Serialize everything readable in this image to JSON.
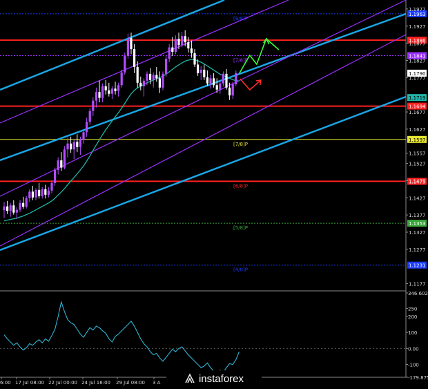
{
  "colors": {
    "background": "#000000",
    "bull": "#b34cff",
    "bear": "#ffffff",
    "ma": "#1fb5a8",
    "channel": "#1aa6e6",
    "inner_channel": "#9b30ff",
    "cci": "#2fb4d4",
    "murray_red": "#ff2020",
    "murray_yellow": "#e8e830",
    "murray_green": "#3aa63a",
    "murray_blue": "#1a3cff",
    "arrow_green": "#35ff35",
    "arrow_red": "#ff2b2b"
  },
  "logo": {
    "text": "instaforex"
  },
  "chart_data": {
    "type": "candlestick",
    "instrument": "",
    "timeframe": "",
    "x_tick_labels": [
      "6:00",
      "17 Jul 08:00",
      "22 Jul 00:00",
      "24 Jul 16:00",
      "29 Jul 08:00",
      "3 A"
    ],
    "y_tick_labels": [
      "1.1977",
      "1.1927",
      "1.1877",
      "1.1827",
      "1.1777",
      "1.1677",
      "1.1627",
      "1.1557",
      "1.1527",
      "1.1477",
      "1.1427",
      "1.1377",
      "1.1327",
      "1.1277",
      "1.1177"
    ],
    "ylim": [
      1.1162,
      1.1999
    ],
    "grid": false,
    "current_price": "1.1790",
    "moving_average_price": "1.1719",
    "murray_levels": [
      {
        "label": "8/8",
        "price": 1.1963,
        "price_text": "1.1963",
        "color": "#1a3cff"
      },
      {
        "label": "",
        "price": 1.1886,
        "price_text": "1.1886",
        "color": "#ff2020"
      },
      {
        "label": "7/8",
        "price": 1.1841,
        "price_text": "1.1841",
        "color": "#9b30ff"
      },
      {
        "label": "",
        "price": 1.1694,
        "price_text": "1.1694",
        "color": "#ff2020"
      },
      {
        "label": "7/8",
        "price": 1.1597,
        "price_text": "1.1597",
        "color": "#e8e830"
      },
      {
        "label": "6/8",
        "price": 1.1475,
        "price_text": "1.1475",
        "color": "#ff2020"
      },
      {
        "label": "5/8",
        "price": 1.1353,
        "price_text": "1.1353",
        "color": "#3aa63a"
      },
      {
        "label": "4/8",
        "price": 1.1231,
        "price_text": "1.1231",
        "color": "#1a3cff"
      }
    ],
    "candles": [
      {
        "o": 1.1391,
        "h": 1.1415,
        "l": 1.1368,
        "c": 1.1402
      },
      {
        "o": 1.1402,
        "h": 1.1418,
        "l": 1.138,
        "c": 1.1389
      },
      {
        "o": 1.1389,
        "h": 1.1412,
        "l": 1.1372,
        "c": 1.1405
      },
      {
        "o": 1.1405,
        "h": 1.142,
        "l": 1.1378,
        "c": 1.1384
      },
      {
        "o": 1.1384,
        "h": 1.14,
        "l": 1.1365,
        "c": 1.1392
      },
      {
        "o": 1.1392,
        "h": 1.142,
        "l": 1.1385,
        "c": 1.1412
      },
      {
        "o": 1.1412,
        "h": 1.143,
        "l": 1.1395,
        "c": 1.1401
      },
      {
        "o": 1.1401,
        "h": 1.1432,
        "l": 1.1396,
        "c": 1.1426
      },
      {
        "o": 1.1426,
        "h": 1.1452,
        "l": 1.1415,
        "c": 1.1445
      },
      {
        "o": 1.1445,
        "h": 1.1462,
        "l": 1.142,
        "c": 1.1428
      },
      {
        "o": 1.1428,
        "h": 1.1455,
        "l": 1.142,
        "c": 1.145
      },
      {
        "o": 1.145,
        "h": 1.147,
        "l": 1.1425,
        "c": 1.1432
      },
      {
        "o": 1.1432,
        "h": 1.1458,
        "l": 1.1425,
        "c": 1.1452
      },
      {
        "o": 1.1452,
        "h": 1.1465,
        "l": 1.1425,
        "c": 1.1436
      },
      {
        "o": 1.1436,
        "h": 1.1458,
        "l": 1.1428,
        "c": 1.1448
      },
      {
        "o": 1.1448,
        "h": 1.1478,
        "l": 1.144,
        "c": 1.147
      },
      {
        "o": 1.147,
        "h": 1.1515,
        "l": 1.1462,
        "c": 1.1508
      },
      {
        "o": 1.1508,
        "h": 1.1545,
        "l": 1.1495,
        "c": 1.1536
      },
      {
        "o": 1.1536,
        "h": 1.156,
        "l": 1.1505,
        "c": 1.1515
      },
      {
        "o": 1.1515,
        "h": 1.1578,
        "l": 1.151,
        "c": 1.1568
      },
      {
        "o": 1.1568,
        "h": 1.1602,
        "l": 1.1545,
        "c": 1.1585
      },
      {
        "o": 1.1585,
        "h": 1.1605,
        "l": 1.1558,
        "c": 1.1568
      },
      {
        "o": 1.1568,
        "h": 1.1598,
        "l": 1.154,
        "c": 1.159
      },
      {
        "o": 1.159,
        "h": 1.1612,
        "l": 1.156,
        "c": 1.1575
      },
      {
        "o": 1.1575,
        "h": 1.1605,
        "l": 1.1552,
        "c": 1.1595
      },
      {
        "o": 1.1595,
        "h": 1.1625,
        "l": 1.1585,
        "c": 1.1618
      },
      {
        "o": 1.1618,
        "h": 1.166,
        "l": 1.1605,
        "c": 1.1648
      },
      {
        "o": 1.1648,
        "h": 1.1688,
        "l": 1.164,
        "c": 1.168
      },
      {
        "o": 1.168,
        "h": 1.172,
        "l": 1.1665,
        "c": 1.171
      },
      {
        "o": 1.171,
        "h": 1.1748,
        "l": 1.169,
        "c": 1.1735
      },
      {
        "o": 1.1735,
        "h": 1.1768,
        "l": 1.1705,
        "c": 1.1718
      },
      {
        "o": 1.1718,
        "h": 1.176,
        "l": 1.1705,
        "c": 1.1752
      },
      {
        "o": 1.1752,
        "h": 1.177,
        "l": 1.1728,
        "c": 1.174
      },
      {
        "o": 1.174,
        "h": 1.1762,
        "l": 1.1722,
        "c": 1.173
      },
      {
        "o": 1.173,
        "h": 1.1752,
        "l": 1.1715,
        "c": 1.1745
      },
      {
        "o": 1.1745,
        "h": 1.1765,
        "l": 1.1728,
        "c": 1.1738
      },
      {
        "o": 1.1738,
        "h": 1.1762,
        "l": 1.1722,
        "c": 1.1755
      },
      {
        "o": 1.1755,
        "h": 1.18,
        "l": 1.1748,
        "c": 1.1792
      },
      {
        "o": 1.1792,
        "h": 1.185,
        "l": 1.1785,
        "c": 1.184
      },
      {
        "o": 1.184,
        "h": 1.1905,
        "l": 1.1832,
        "c": 1.1892
      },
      {
        "o": 1.1892,
        "h": 1.1908,
        "l": 1.1845,
        "c": 1.186
      },
      {
        "o": 1.186,
        "h": 1.1875,
        "l": 1.179,
        "c": 1.1808
      },
      {
        "o": 1.1808,
        "h": 1.1825,
        "l": 1.1748,
        "c": 1.1762
      },
      {
        "o": 1.1762,
        "h": 1.178,
        "l": 1.174,
        "c": 1.1752
      },
      {
        "o": 1.1752,
        "h": 1.1775,
        "l": 1.1722,
        "c": 1.1768
      },
      {
        "o": 1.1768,
        "h": 1.1795,
        "l": 1.1755,
        "c": 1.1788
      },
      {
        "o": 1.1788,
        "h": 1.1805,
        "l": 1.1758,
        "c": 1.177
      },
      {
        "o": 1.177,
        "h": 1.1792,
        "l": 1.1748,
        "c": 1.1785
      },
      {
        "o": 1.1785,
        "h": 1.1808,
        "l": 1.1765,
        "c": 1.1775
      },
      {
        "o": 1.1775,
        "h": 1.1795,
        "l": 1.1732,
        "c": 1.1748
      },
      {
        "o": 1.1748,
        "h": 1.1795,
        "l": 1.174,
        "c": 1.1788
      },
      {
        "o": 1.1788,
        "h": 1.184,
        "l": 1.178,
        "c": 1.1832
      },
      {
        "o": 1.1832,
        "h": 1.1875,
        "l": 1.1822,
        "c": 1.1865
      },
      {
        "o": 1.1865,
        "h": 1.1895,
        "l": 1.184,
        "c": 1.1852
      },
      {
        "o": 1.1852,
        "h": 1.19,
        "l": 1.1845,
        "c": 1.189
      },
      {
        "o": 1.189,
        "h": 1.1908,
        "l": 1.186,
        "c": 1.1872
      },
      {
        "o": 1.1872,
        "h": 1.191,
        "l": 1.1865,
        "c": 1.1898
      },
      {
        "o": 1.1898,
        "h": 1.1915,
        "l": 1.1868,
        "c": 1.188
      },
      {
        "o": 1.188,
        "h": 1.1895,
        "l": 1.185,
        "c": 1.1862
      },
      {
        "o": 1.1862,
        "h": 1.1885,
        "l": 1.1835,
        "c": 1.1848
      },
      {
        "o": 1.1848,
        "h": 1.186,
        "l": 1.1808,
        "c": 1.1815
      },
      {
        "o": 1.1815,
        "h": 1.183,
        "l": 1.1782,
        "c": 1.179
      },
      {
        "o": 1.179,
        "h": 1.181,
        "l": 1.177,
        "c": 1.18
      },
      {
        "o": 1.18,
        "h": 1.1815,
        "l": 1.177,
        "c": 1.1778
      },
      {
        "o": 1.1778,
        "h": 1.1798,
        "l": 1.1752,
        "c": 1.176
      },
      {
        "o": 1.176,
        "h": 1.1785,
        "l": 1.1745,
        "c": 1.1775
      },
      {
        "o": 1.1775,
        "h": 1.179,
        "l": 1.1748,
        "c": 1.1755
      },
      {
        "o": 1.1755,
        "h": 1.1775,
        "l": 1.1732,
        "c": 1.1742
      },
      {
        "o": 1.1742,
        "h": 1.1768,
        "l": 1.173,
        "c": 1.176
      },
      {
        "o": 1.176,
        "h": 1.1795,
        "l": 1.1752,
        "c": 1.1788
      },
      {
        "o": 1.1788,
        "h": 1.1802,
        "l": 1.1742,
        "c": 1.1748
      },
      {
        "o": 1.1748,
        "h": 1.1762,
        "l": 1.1712,
        "c": 1.1725
      },
      {
        "o": 1.1725,
        "h": 1.1765,
        "l": 1.1715,
        "c": 1.1758
      },
      {
        "o": 1.1758,
        "h": 1.1798,
        "l": 1.1752,
        "c": 1.179
      }
    ],
    "moving_average": [
      1.136,
      1.1362,
      1.1364,
      1.1366,
      1.1368,
      1.1371,
      1.1374,
      1.1378,
      1.1382,
      1.1387,
      1.1392,
      1.1397,
      1.1402,
      1.1407,
      1.1412,
      1.1418,
      1.1426,
      1.1435,
      1.1444,
      1.1454,
      1.1465,
      1.1476,
      1.1486,
      1.1497,
      1.1508,
      1.152,
      1.1534,
      1.1549,
      1.1565,
      1.1581,
      1.1596,
      1.1611,
      1.1625,
      1.1638,
      1.1651,
      1.1663,
      1.1675,
      1.1688,
      1.1702,
      1.1717,
      1.173,
      1.174,
      1.1747,
      1.1752,
      1.1757,
      1.1762,
      1.1766,
      1.177,
      1.1774,
      1.1777,
      1.1781,
      1.1787,
      1.1794,
      1.1801,
      1.1808,
      1.1814,
      1.182,
      1.1825,
      1.1828,
      1.183,
      1.1829,
      1.1826,
      1.1822,
      1.1817,
      1.1811,
      1.1805,
      1.1799,
      1.1793,
      1.1787,
      1.1783,
      1.1779,
      1.1775,
      1.1771,
      1.1768,
      1.1767
    ],
    "cci": {
      "name": "",
      "ylim": [
        -179.8754,
        346.6021
      ],
      "y_tick_labels": [
        "346.6021",
        "250",
        "200",
        "100",
        "0.00",
        "-100",
        "-179.8754"
      ],
      "values": [
        85,
        60,
        40,
        20,
        35,
        10,
        -10,
        5,
        30,
        20,
        40,
        55,
        35,
        60,
        45,
        80,
        120,
        200,
        290,
        230,
        180,
        160,
        150,
        120,
        90,
        70,
        100,
        130,
        115,
        140,
        130,
        110,
        95,
        60,
        40,
        75,
        90,
        110,
        130,
        150,
        170,
        140,
        100,
        60,
        30,
        10,
        -20,
        -40,
        -30,
        -60,
        -80,
        -55,
        -30,
        -5,
        -20,
        0,
        10,
        -15,
        -40,
        -60,
        -80,
        -100,
        -120,
        -110,
        -90,
        -120,
        -140,
        -155,
        -135,
        -150,
        -120,
        -95,
        -100,
        -70,
        -20
      ]
    }
  }
}
